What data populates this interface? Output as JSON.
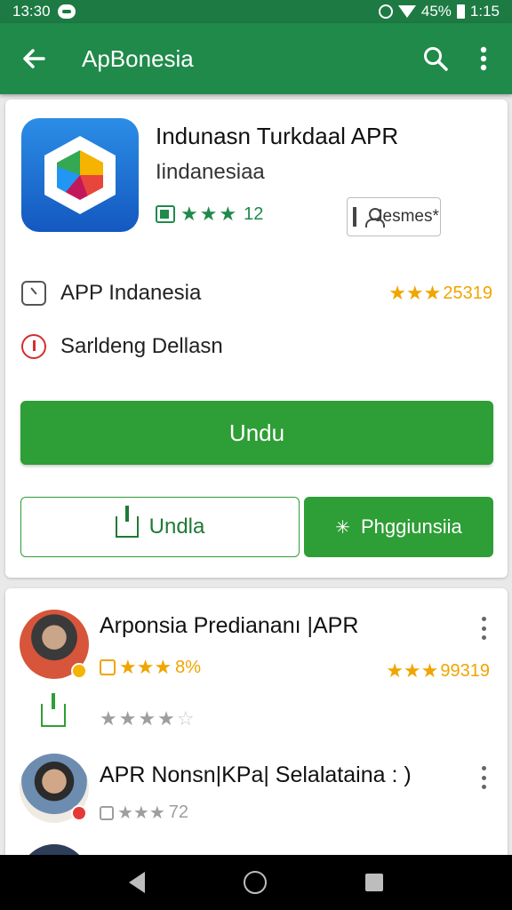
{
  "status": {
    "time": "13:30",
    "battery": "45%",
    "clock": "1:15"
  },
  "appbar": {
    "title": "ApBonesia"
  },
  "app": {
    "name": "Indunasn Turkdaal APR",
    "subtitle": "Iindanesiaa",
    "rating_count": "12",
    "chip_label": "Jesmes*",
    "row1_label": "APP Indanesia",
    "row1_stat": "25319",
    "row2_label": "Sarldeng Dellasn"
  },
  "buttons": {
    "primary": "Undu",
    "outline": "Undla",
    "filled": "Phggiunsiia"
  },
  "reviews": [
    {
      "title": "Arponsia Prediananı |APR",
      "pct": "8%",
      "count": "99319"
    },
    {
      "title": "APR Nonsn|KPa| Selalataina : )",
      "count": "72"
    }
  ],
  "colors": {
    "accent": "#2e9e36",
    "appbar": "#1f8a4a",
    "star": "#f0a500"
  }
}
